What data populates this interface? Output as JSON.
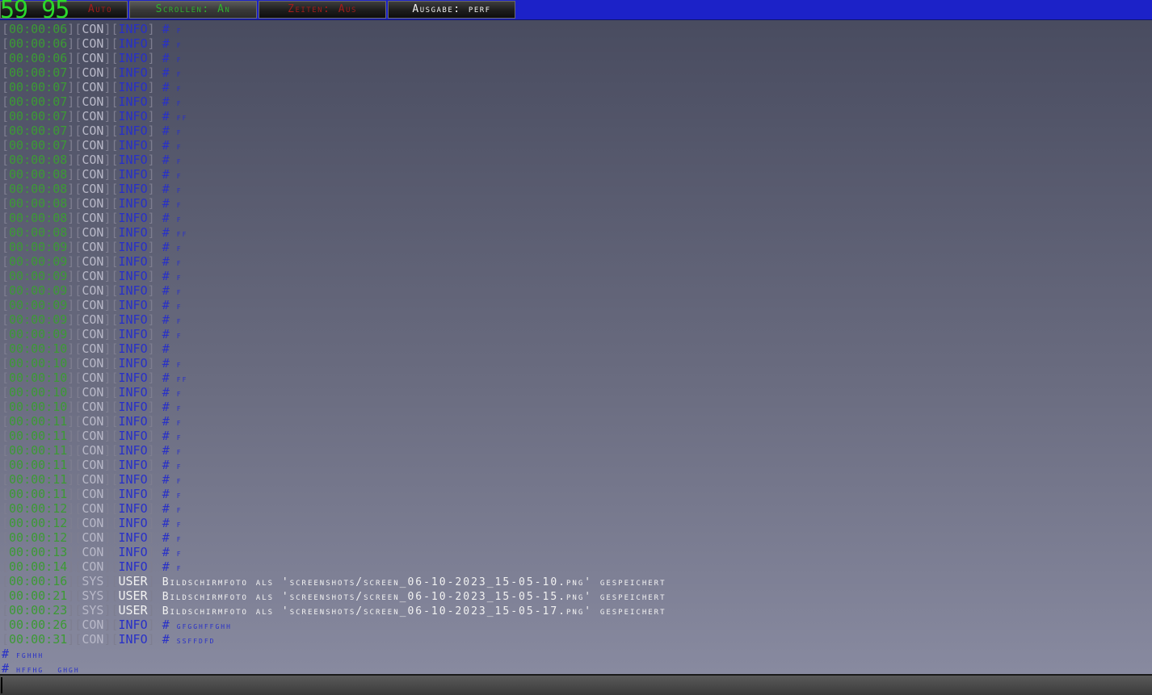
{
  "toolbar": {
    "btn_log": "Auto",
    "btn_scroll": "Scrollen: An",
    "btn_time": "Zeiten: Aus",
    "btn_output": "Ausgabe: perf",
    "fps": "59 95"
  },
  "log": [
    {
      "ts": "00:00:06",
      "src": "CON",
      "lvl": "INFO",
      "msg": "f"
    },
    {
      "ts": "00:00:06",
      "src": "CON",
      "lvl": "INFO",
      "msg": "f"
    },
    {
      "ts": "00:00:06",
      "src": "CON",
      "lvl": "INFO",
      "msg": "f"
    },
    {
      "ts": "00:00:07",
      "src": "CON",
      "lvl": "INFO",
      "msg": "f"
    },
    {
      "ts": "00:00:07",
      "src": "CON",
      "lvl": "INFO",
      "msg": "f"
    },
    {
      "ts": "00:00:07",
      "src": "CON",
      "lvl": "INFO",
      "msg": "f"
    },
    {
      "ts": "00:00:07",
      "src": "CON",
      "lvl": "INFO",
      "msg": "ff"
    },
    {
      "ts": "00:00:07",
      "src": "CON",
      "lvl": "INFO",
      "msg": "f"
    },
    {
      "ts": "00:00:07",
      "src": "CON",
      "lvl": "INFO",
      "msg": "f"
    },
    {
      "ts": "00:00:08",
      "src": "CON",
      "lvl": "INFO",
      "msg": "f"
    },
    {
      "ts": "00:00:08",
      "src": "CON",
      "lvl": "INFO",
      "msg": "f"
    },
    {
      "ts": "00:00:08",
      "src": "CON",
      "lvl": "INFO",
      "msg": "f"
    },
    {
      "ts": "00:00:08",
      "src": "CON",
      "lvl": "INFO",
      "msg": "f"
    },
    {
      "ts": "00:00:08",
      "src": "CON",
      "lvl": "INFO",
      "msg": "f"
    },
    {
      "ts": "00:00:08",
      "src": "CON",
      "lvl": "INFO",
      "msg": "ff"
    },
    {
      "ts": "00:00:09",
      "src": "CON",
      "lvl": "INFO",
      "msg": "f"
    },
    {
      "ts": "00:00:09",
      "src": "CON",
      "lvl": "INFO",
      "msg": "f"
    },
    {
      "ts": "00:00:09",
      "src": "CON",
      "lvl": "INFO",
      "msg": "f"
    },
    {
      "ts": "00:00:09",
      "src": "CON",
      "lvl": "INFO",
      "msg": "f"
    },
    {
      "ts": "00:00:09",
      "src": "CON",
      "lvl": "INFO",
      "msg": "f"
    },
    {
      "ts": "00:00:09",
      "src": "CON",
      "lvl": "INFO",
      "msg": "f"
    },
    {
      "ts": "00:00:09",
      "src": "CON",
      "lvl": "INFO",
      "msg": "f"
    },
    {
      "ts": "00:00:10",
      "src": "CON",
      "lvl": "INFO",
      "msg": ""
    },
    {
      "ts": "00:00:10",
      "src": "CON",
      "lvl": "INFO",
      "msg": "f"
    },
    {
      "ts": "00:00:10",
      "src": "CON",
      "lvl": "INFO",
      "msg": "ff"
    },
    {
      "ts": "00:00:10",
      "src": "CON",
      "lvl": "INFO",
      "msg": "f"
    },
    {
      "ts": "00:00:10",
      "src": "CON",
      "lvl": "INFO",
      "msg": "f"
    },
    {
      "ts": "00:00:11",
      "src": "CON",
      "lvl": "INFO",
      "msg": "f"
    },
    {
      "ts": "00:00:11",
      "src": "CON",
      "lvl": "INFO",
      "msg": "f"
    },
    {
      "ts": "00:00:11",
      "src": "CON",
      "lvl": "INFO",
      "msg": "f"
    },
    {
      "ts": "00:00:11",
      "src": "CON",
      "lvl": "INFO",
      "msg": "f"
    },
    {
      "ts": "00:00:11",
      "src": "CON",
      "lvl": "INFO",
      "msg": "f"
    },
    {
      "ts": "00:00:11",
      "src": "CON",
      "lvl": "INFO",
      "msg": "f"
    },
    {
      "ts": "00:00:12",
      "src": "CON",
      "lvl": "INFO",
      "msg": "f"
    },
    {
      "ts": "00:00:12",
      "src": "CON",
      "lvl": "INFO",
      "msg": "f"
    },
    {
      "ts": "00:00:12",
      "src": "CON",
      "lvl": "INFO",
      "msg": "f"
    },
    {
      "ts": "00:00:13",
      "src": "CON",
      "lvl": "INFO",
      "msg": "f"
    },
    {
      "ts": "00:00:14",
      "src": "CON",
      "lvl": "INFO",
      "msg": "f"
    },
    {
      "ts": "00:00:16",
      "src": "SYS",
      "lvl": "USER",
      "sys": true,
      "msg": "Bildschirmfoto als 'screenshots/screen_06-10-2023_15-05-10.png' gespeichert"
    },
    {
      "ts": "00:00:21",
      "src": "SYS",
      "lvl": "USER",
      "sys": true,
      "msg": "Bildschirmfoto als 'screenshots/screen_06-10-2023_15-05-15.png' gespeichert"
    },
    {
      "ts": "00:00:23",
      "src": "SYS",
      "lvl": "USER",
      "sys": true,
      "msg": "Bildschirmfoto als 'screenshots/screen_06-10-2023_15-05-17.png' gespeichert"
    },
    {
      "ts": "00:00:26",
      "src": "CON",
      "lvl": "INFO",
      "msg": "gfgghffghh"
    },
    {
      "ts": "00:00:31",
      "src": "CON",
      "lvl": "INFO",
      "msg": "ssffdfd"
    }
  ],
  "pending": [
    "fghhh",
    "hffhg  ghgh"
  ],
  "colors": {
    "topbar": "#1c22c8",
    "timestamp": "#3c9a34",
    "info": "#2830c8",
    "user": "#f2f2f2",
    "fps": "#2bd92b",
    "btn_red": "#a01c1c",
    "btn_green": "#2fb02f",
    "btn_white": "#f0f0f0"
  }
}
